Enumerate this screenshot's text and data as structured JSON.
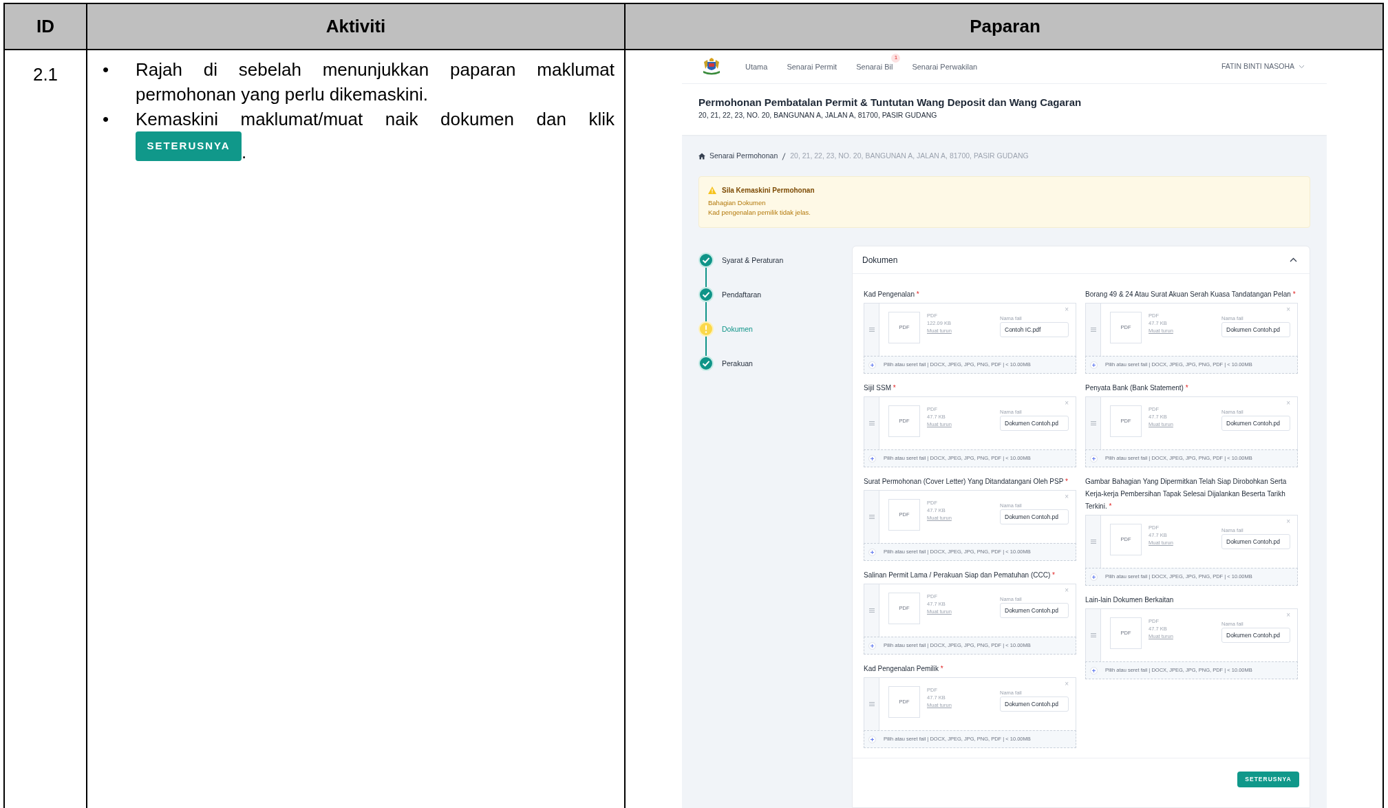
{
  "table": {
    "columns": [
      "ID",
      "Aktiviti",
      "Paparan"
    ],
    "rows": [
      {
        "id": "2.1",
        "steps": [
          {
            "bullet": "•",
            "text": "Rajah di sebelah menunjukkan paparan maklumat permohonan yang perlu dikemaskini."
          },
          {
            "bullet": "•",
            "text": "Kemaskini maklumat/muat naik dokumen dan klik",
            "button": "SETERUSNYA",
            "suffix": "."
          }
        ]
      }
    ]
  },
  "screen": {
    "nav": {
      "items": [
        {
          "label": "Utama"
        },
        {
          "label": "Senarai Permit"
        },
        {
          "label": "Senarai Bil",
          "badge": "1"
        },
        {
          "label": "Senarai Perwakilan"
        }
      ],
      "user": "FATIN BINTI NASOHA"
    },
    "title": "Permohonan Pembatalan Permit & Tuntutan Wang Deposit dan Wang Cagaran",
    "address": "20, 21, 22, 23, NO. 20, BANGUNAN A, JALAN A, 81700, PASIR GUDANG",
    "breadcrumb": [
      "Senarai Permohonan",
      "20, 21, 22, 23, NO. 20, BANGUNAN A, JALAN A, 81700, PASIR GUDANG"
    ],
    "alert": {
      "title": "Sila Kemaskini Permohonan",
      "lines": [
        "Bahagian Dokumen",
        "Kad pengenalan pemilik tidak jelas."
      ]
    },
    "steps": [
      {
        "label": "Syarat & Peraturan",
        "kind": "done",
        "selected": false
      },
      {
        "label": "Pendaftaran",
        "kind": "done",
        "selected": false
      },
      {
        "label": "Dokumen",
        "kind": "warning",
        "selected": true
      },
      {
        "label": "Perakuan",
        "kind": "done",
        "selected": false
      }
    ],
    "card": {
      "title": "Dokumen",
      "expanded": true,
      "columns": [
        [
          {
            "label": "Kad Pengenalan",
            "mark": "*",
            "thumb": "PDF",
            "type": "PDF",
            "size": "122.09 KB",
            "download": "Muat turun",
            "name_label": "Nama fail",
            "name": "Contoh IC.pdf",
            "close": "×",
            "dropzone": "Pilih atau seret fail | DOCX, JPEG, JPG, PNG, PDF | < 10.00MB"
          },
          {
            "label": "Sijil SSM",
            "mark": "*",
            "thumb": "PDF",
            "type": "PDF",
            "size": "47.7 KB",
            "download": "Muat turun",
            "name_label": "Nama fail",
            "name": "Dokumen Contoh.pd",
            "close": "×",
            "dropzone": "Pilih atau seret fail | DOCX, JPEG, JPG, PNG, PDF | < 10.00MB"
          },
          {
            "label": "Surat Permohonan (Cover Letter) Yang Ditandatangani Oleh PSP",
            "mark": "*",
            "thumb": "PDF",
            "type": "PDF",
            "size": "47.7 KB",
            "download": "Muat turun",
            "name_label": "Nama fail",
            "name": "Dokumen Contoh.pd",
            "close": "×",
            "dropzone": "Pilih atau seret fail | DOCX, JPEG, JPG, PNG, PDF | < 10.00MB"
          },
          {
            "label": "Salinan Permit Lama / Perakuan Siap dan Pematuhan (CCC)",
            "mark": "*",
            "thumb": "PDF",
            "type": "PDF",
            "size": "47.7 KB",
            "download": "Muat turun",
            "name_label": "Nama fail",
            "name": "Dokumen Contoh.pd",
            "close": "×",
            "dropzone": "Pilih atau seret fail | DOCX, JPEG, JPG, PNG, PDF | < 10.00MB"
          },
          {
            "label": "Kad Pengenalan Pemilik",
            "mark": "*",
            "thumb": "PDF",
            "type": "PDF",
            "size": "47.7 KB",
            "download": "Muat turun",
            "name_label": "Nama fail",
            "name": "Dokumen Contoh.pd",
            "close": "×",
            "dropzone": "Pilih atau seret fail | DOCX, JPEG, JPG, PNG, PDF | < 10.00MB"
          }
        ],
        [
          {
            "label": "Borang 49 & 24 Atau Surat Akuan Serah Kuasa Tandatangan Pelan",
            "mark": "*",
            "thumb": "PDF",
            "type": "PDF",
            "size": "47.7 KB",
            "download": "Muat turun",
            "name_label": "Nama fail",
            "name": "Dokumen Contoh.pd",
            "close": "×",
            "dropzone": "Pilih atau seret fail | DOCX, JPEG, JPG, PNG, PDF | < 10.00MB"
          },
          {
            "label": "Penyata Bank (Bank Statement)",
            "mark": "*",
            "thumb": "PDF",
            "type": "PDF",
            "size": "47.7 KB",
            "download": "Muat turun",
            "name_label": "Nama fail",
            "name": "Dokumen Contoh.pd",
            "close": "×",
            "dropzone": "Pilih atau seret fail | DOCX, JPEG, JPG, PNG, PDF | < 10.00MB"
          },
          {
            "label": "Gambar Bahagian Yang Dipermitkan Telah Siap Dirobohkan Serta Kerja-kerja Pembersihan Tapak Selesai Dijalankan Beserta Tarikh Terkini.",
            "mark": "*",
            "thumb": "PDF",
            "type": "PDF",
            "size": "47.7 KB",
            "download": "Muat turun",
            "name_label": "Nama fail",
            "name": "Dokumen Contoh.pd",
            "close": "×",
            "dropzone": "Pilih atau seret fail | DOCX, JPEG, JPG, PNG, PDF | < 10.00MB"
          },
          {
            "label": "Lain-lain Dokumen Berkaitan",
            "thumb": "PDF",
            "type": "PDF",
            "size": "47.7 KB",
            "download": "Muat turun",
            "name_label": "Nama fail",
            "name": "Dokumen Contoh.pd",
            "close": "×",
            "dropzone": "Pilih atau seret fail | DOCX, JPEG, JPG, PNG, PDF | < 10.00MB"
          }
        ]
      ],
      "button": "SETERUSNYA"
    }
  }
}
